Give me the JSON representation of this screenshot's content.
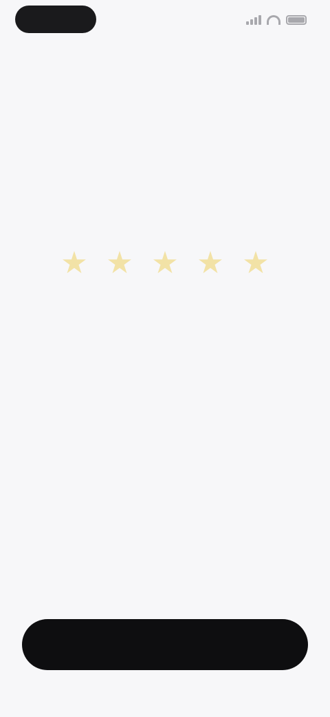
{
  "status_bar": {
    "time": "",
    "icons": [
      "signal-icon",
      "wifi-icon",
      "battery-icon"
    ]
  },
  "header": {
    "title": ""
  },
  "rating": {
    "stars": [
      "★",
      "★",
      "★",
      "★",
      "★"
    ],
    "star_color": "#f2e2a6"
  },
  "main": {
    "headline": "",
    "subtext": ""
  },
  "footer": {
    "hint": "",
    "primary_button_label": "",
    "button_color": "#0e0e10"
  }
}
